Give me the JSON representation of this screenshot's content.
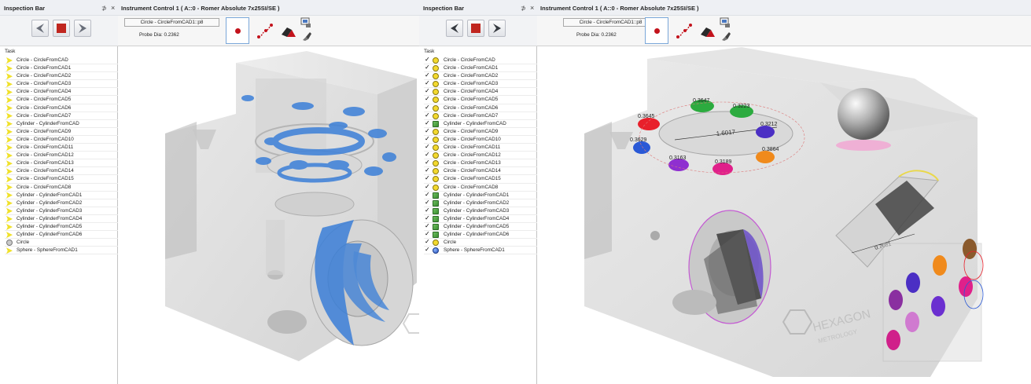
{
  "colors": {
    "panel_header": "#eef0f4",
    "stop_red": "#c0261f",
    "record_red": "#c3131c",
    "selection_blue": "#7aa7d9",
    "scan_blue": "#3b7fd8"
  },
  "left": {
    "inspection_bar": {
      "title": "Inspection Bar",
      "pin_icon": "pin-icon",
      "pin_glyph": "⊅",
      "close_icon": "close-icon",
      "close_glyph": "×",
      "task_header": "Task",
      "tasks": [
        {
          "label": "Circle - CircleFromCAD",
          "icon": "circle-arrow-icon"
        },
        {
          "label": "Circle - CircleFromCAD1",
          "icon": "circle-arrow-icon"
        },
        {
          "label": "Circle - CircleFromCAD2",
          "icon": "circle-arrow-icon"
        },
        {
          "label": "Circle - CircleFromCAD3",
          "icon": "circle-arrow-icon"
        },
        {
          "label": "Circle - CircleFromCAD4",
          "icon": "circle-arrow-icon"
        },
        {
          "label": "Circle - CircleFromCAD5",
          "icon": "circle-arrow-icon"
        },
        {
          "label": "Circle - CircleFromCAD6",
          "icon": "circle-arrow-icon"
        },
        {
          "label": "Circle - CircleFromCAD7",
          "icon": "circle-arrow-icon"
        },
        {
          "label": "Cylinder - CylinderFromCAD",
          "icon": "cylinder-arrow-icon"
        },
        {
          "label": "Circle - CircleFromCAD9",
          "icon": "circle-arrow-icon"
        },
        {
          "label": "Circle - CircleFromCAD10",
          "icon": "circle-arrow-icon"
        },
        {
          "label": "Circle - CircleFromCAD11",
          "icon": "circle-arrow-icon"
        },
        {
          "label": "Circle - CircleFromCAD12",
          "icon": "circle-arrow-icon"
        },
        {
          "label": "Circle - CircleFromCAD13",
          "icon": "circle-arrow-icon"
        },
        {
          "label": "Circle - CircleFromCAD14",
          "icon": "circle-arrow-icon"
        },
        {
          "label": "Circle - CircleFromCAD15",
          "icon": "circle-arrow-icon"
        },
        {
          "label": "Circle - CircleFromCAD8",
          "icon": "circle-arrow-icon"
        },
        {
          "label": "Cylinder - CylinderFromCAD1",
          "icon": "cylinder-arrow-icon"
        },
        {
          "label": "Cylinder - CylinderFromCAD2",
          "icon": "cylinder-arrow-icon"
        },
        {
          "label": "Cylinder - CylinderFromCAD3",
          "icon": "cylinder-arrow-icon"
        },
        {
          "label": "Cylinder - CylinderFromCAD4",
          "icon": "cylinder-arrow-icon"
        },
        {
          "label": "Cylinder - CylinderFromCAD5",
          "icon": "cylinder-arrow-icon"
        },
        {
          "label": "Cylinder - CylinderFromCAD6",
          "icon": "cylinder-arrow-icon"
        },
        {
          "label": "Circle",
          "icon": "circle-gray-icon"
        },
        {
          "label": "Sphere - SphereFromCAD1",
          "icon": "sphere-arrow-icon"
        }
      ]
    },
    "instrument": {
      "title": "Instrument Control 1 ( A::0 - Romer Absolute 7x25SI/SE )",
      "feature_name": "Circle - CircleFromCAD1::p8",
      "probe_dia": "Probe Dia: 0.2362"
    }
  },
  "right": {
    "inspection_bar": {
      "title": "Inspection Bar",
      "pin_icon": "pin-icon",
      "pin_glyph": "⊅",
      "close_icon": "close-icon",
      "close_glyph": "×",
      "task_header": "Task",
      "tasks": [
        {
          "label": "Circle - CircleFromCAD",
          "icon": "circle-done-icon"
        },
        {
          "label": "Circle - CircleFromCAD1",
          "icon": "circle-done-icon"
        },
        {
          "label": "Circle - CircleFromCAD2",
          "icon": "circle-done-icon"
        },
        {
          "label": "Circle - CircleFromCAD3",
          "icon": "circle-done-icon"
        },
        {
          "label": "Circle - CircleFromCAD4",
          "icon": "circle-done-icon"
        },
        {
          "label": "Circle - CircleFromCAD5",
          "icon": "circle-done-icon"
        },
        {
          "label": "Circle - CircleFromCAD6",
          "icon": "circle-done-icon"
        },
        {
          "label": "Circle - CircleFromCAD7",
          "icon": "circle-done-icon"
        },
        {
          "label": "Cylinder - CylinderFromCAD",
          "icon": "cylinder-done-icon"
        },
        {
          "label": "Circle - CircleFromCAD9",
          "icon": "circle-done-icon"
        },
        {
          "label": "Circle - CircleFromCAD10",
          "icon": "circle-done-icon"
        },
        {
          "label": "Circle - CircleFromCAD11",
          "icon": "circle-done-icon"
        },
        {
          "label": "Circle - CircleFromCAD12",
          "icon": "circle-done-icon"
        },
        {
          "label": "Circle - CircleFromCAD13",
          "icon": "circle-done-icon"
        },
        {
          "label": "Circle - CircleFromCAD14",
          "icon": "circle-done-icon"
        },
        {
          "label": "Circle - CircleFromCAD15",
          "icon": "circle-done-icon"
        },
        {
          "label": "Circle - CircleFromCAD8",
          "icon": "circle-done-icon"
        },
        {
          "label": "Cylinder - CylinderFromCAD1",
          "icon": "cylinder-done-icon"
        },
        {
          "label": "Cylinder - CylinderFromCAD2",
          "icon": "cylinder-done-icon"
        },
        {
          "label": "Cylinder - CylinderFromCAD3",
          "icon": "cylinder-done-icon"
        },
        {
          "label": "Cylinder - CylinderFromCAD4",
          "icon": "cylinder-done-icon"
        },
        {
          "label": "Cylinder - CylinderFromCAD5",
          "icon": "cylinder-done-icon"
        },
        {
          "label": "Cylinder - CylinderFromCAD6",
          "icon": "cylinder-done-icon"
        },
        {
          "label": "Circle",
          "icon": "circle-done-icon"
        },
        {
          "label": "Sphere - SphereFromCAD1",
          "icon": "sphere-done-icon"
        }
      ]
    },
    "instrument": {
      "title": "Instrument Control 1 ( A::0 - Romer Absolute 7x25SI/SE )",
      "feature_name": "Circle - CircleFromCAD1::p8",
      "probe_dia": "Probe Dia: 0.2362"
    },
    "measurements": {
      "top_1": "0.3647",
      "top_2": "0.3223",
      "left_1": "0.3645",
      "left_2": "0.3629",
      "right_1": "0.3212",
      "right_2": "0.3864",
      "bottom_1": "0.3163",
      "bottom_2": "0.3189",
      "center": "1.6017",
      "ramp": "0.7081"
    },
    "watermark": {
      "brand": "HEXAGON",
      "sub": "METROLOGY"
    }
  }
}
